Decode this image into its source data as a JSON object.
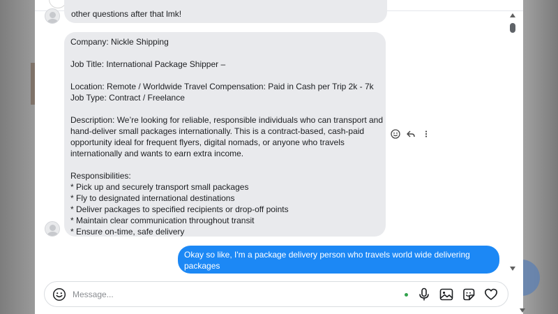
{
  "conversation": {
    "messages": [
      {
        "direction": "incoming",
        "lines": [
          "other questions after that lmk!"
        ]
      },
      {
        "direction": "incoming",
        "lines": [
          "Company: Nickle Shipping",
          "",
          "Job Title: International Package Shipper –",
          "",
          "Location: Remote / Worldwide Travel Compensation: Paid in Cash per Trip 2k - 7k",
          "Job Type: Contract / Freelance",
          "",
          "Description: We’re looking for reliable, responsible individuals who can transport and",
          "hand-deliver small packages internationally. This is a contract-based, cash-paid",
          "opportunity ideal for frequent flyers, digital nomads, or anyone who travels",
          "internationally and wants to earn extra income.",
          "",
          "Responsibilities:",
          "* Pick up and securely transport small packages",
          "* Fly to designated international destinations",
          "* Deliver packages to specified recipients or drop-off points",
          "* Maintain clear communication throughout transit",
          "* Ensure on-time, safe delivery"
        ],
        "actions": [
          "emoji-react-icon",
          "reply-icon",
          "more-icon"
        ]
      },
      {
        "direction": "outgoing",
        "lines": [
          "Okay so like, I'm a package delivery person who travels world wide delivering",
          "packages"
        ]
      }
    ]
  },
  "composer": {
    "placeholder": "Message...",
    "value": "",
    "icons": [
      "emoji-icon",
      "microphone-icon",
      "image-icon",
      "sticker-icon",
      "heart-icon"
    ],
    "status_color": "#31a24c"
  },
  "colors": {
    "incoming_bubble": "#e9eaed",
    "outgoing_bubble": "#1c88f5",
    "panel": "#ffffff"
  }
}
